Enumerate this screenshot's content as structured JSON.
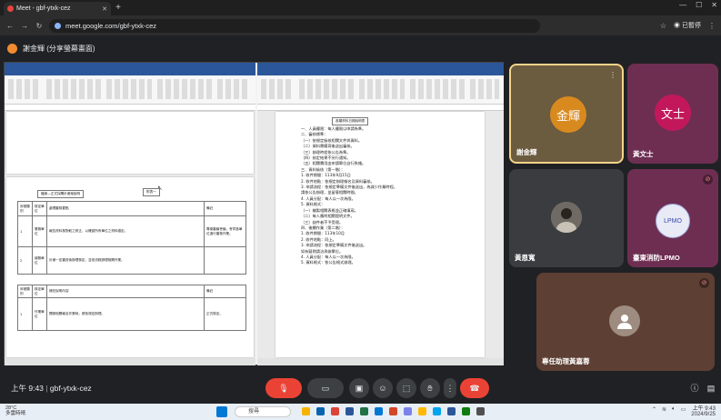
{
  "browser": {
    "tab_title": "Meet - gbf-ytxk-cez",
    "url": "meet.google.com/gbf-ytxk-cez",
    "profile_label": "已暫停"
  },
  "presenter": {
    "label": "謝金輝 (分享螢幕畫面)"
  },
  "shared_screen": {
    "left_doc": {
      "box_label_a": "檔案—正式採購計畫案說明",
      "box_label_b": "附表一",
      "table_headers": [
        "序號類別",
        "核定單位",
        "處理審核要點",
        "備註"
      ],
      "rows": [
        {
          "no": "1",
          "unit": "業務單位",
          "text": "報告資料核對較之修正，以確認所有單位之資料穩定。",
          "note": "專案審議會議，會同各單位進行審核作業。"
        },
        {
          "no": "2",
          "unit": "總務單位",
          "text": "計畫一定審查後辦理核定，並依流程辦理相關作業。",
          "note": ""
        }
      ],
      "table2_headers": [
        "序號類別",
        "核定單位",
        "補充說明內容",
        "備註"
      ],
      "table2_rows": [
        {
          "no": "1",
          "unit": "作業單位",
          "text": "開辦相關報名作業時，請依規定辦理。",
          "note": "正式核定。"
        }
      ]
    },
    "right_doc": {
      "box_label": "各類資料日期說明表",
      "lines": [
        "一、人員權限：每人權限以申請為準。",
        "二、審核標準：",
        "（一）依規定檢核相關文件與資料。",
        "（二）資料需備齊後送出審核。",
        "（三）辦理時程依公告為準。",
        "（四）核定結果不另行通知。",
        "（五）相關費用由申請單位自行負擔。",
        "三、資料檢核（第一階）：",
        "1. 收件期間：113年9月15日",
        "2. 收件地點：依規定辦理報名及資料審核。",
        "3. 申請流程：依規定準備文件後送出，為減少作業時程。",
        "   請依公告辦理，並留意相關時間。",
        "4. 人員分配：每人以一次為限。",
        "5. 資料格式：",
        "（一）繪製相關表格並正確填寫。",
        "（二）每人應附相關證明文件。",
        "（三）缺件者不予受理。",
        "四、後續作業（第二階）：",
        "1. 收件期間：113年10月",
        "2. 收件地點：同上。",
        "3. 申請流程：依規定準備文件後送出。",
        "   如有疑問請洽承辦單位。",
        "4. 人員分配：每人以一次為限。",
        "5. 資料格式：依公告格式辦理。"
      ]
    }
  },
  "participants": [
    {
      "name": "謝金輝",
      "avatar_text": "金輝",
      "color": "#d88a1f",
      "tile_bg": "#6b5b3f"
    },
    {
      "name": "黃文士",
      "avatar_text": "文士",
      "color": "#c2185b",
      "tile_bg": "#6e2e52"
    },
    {
      "name": "黃恩寬",
      "avatar_text": "",
      "color": "#8f8f8f",
      "tile_bg": "#3a3c3f"
    },
    {
      "name": "臺東消防LPMO",
      "avatar_text": "LPMO",
      "color": "#e8eaf6",
      "tile_bg": "#6e2e52"
    },
    {
      "name": "專任助理黃嘉蓉",
      "avatar_text": "",
      "color": "#9e8c80",
      "tile_bg": "#5d3f33"
    }
  ],
  "meeting": {
    "time": "上午 9:43",
    "code": "gbf-ytxk-cez"
  },
  "taskbar": {
    "weather_temp": "28°C",
    "weather_desc": "多雲時晴",
    "search": "搜尋",
    "clock_time": "上午 9:43",
    "clock_date": "2024/9/25"
  }
}
